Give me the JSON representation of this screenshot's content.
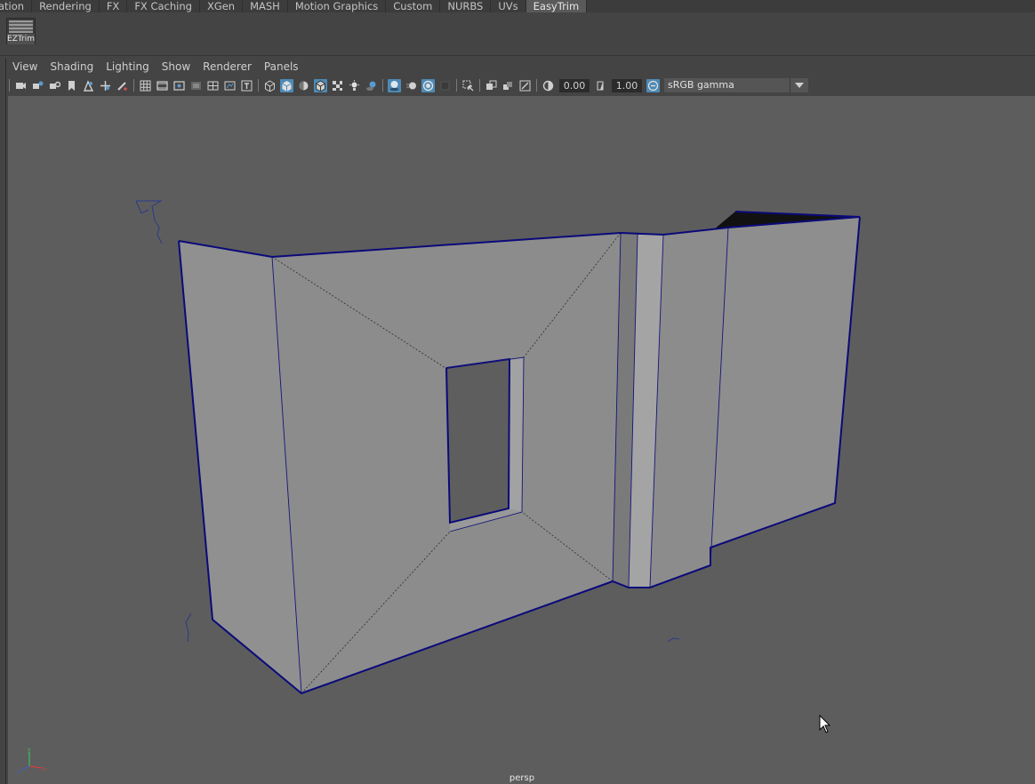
{
  "shelf_tabs": [
    {
      "label": "ation",
      "active": false
    },
    {
      "label": "Rendering",
      "active": false
    },
    {
      "label": "FX",
      "active": false
    },
    {
      "label": "FX Caching",
      "active": false
    },
    {
      "label": "XGen",
      "active": false
    },
    {
      "label": "MASH",
      "active": false
    },
    {
      "label": "Motion Graphics",
      "active": false
    },
    {
      "label": "Custom",
      "active": false
    },
    {
      "label": "NURBS",
      "active": false
    },
    {
      "label": "UVs",
      "active": false
    },
    {
      "label": "EasyTrim",
      "active": true
    }
  ],
  "shelf": {
    "button_label": "EZTrim"
  },
  "panel_menu": [
    "View",
    "Shading",
    "Lighting",
    "Show",
    "Renderer",
    "Panels"
  ],
  "toolbar": {
    "exposure_value": "0.00",
    "gamma_value": "1.00",
    "color_space": "sRGB gamma"
  },
  "viewport": {
    "camera_label": "persp",
    "background_color": "#5d5d5d",
    "mesh_face_color": "#8c8c8c",
    "selection_edge_color": "#0a0a7a"
  },
  "colors": {
    "active_tab": "#5a5a5a",
    "toggle_on": "#4d8ab5"
  }
}
